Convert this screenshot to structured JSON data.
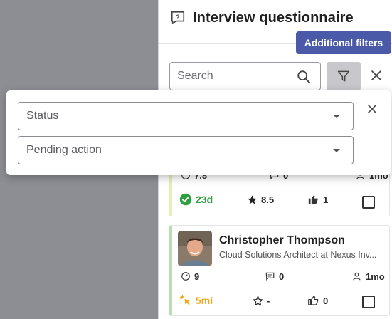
{
  "panel": {
    "title": "Interview questionnaire",
    "additional_filters_label": "Additional filters",
    "search_placeholder": "Search"
  },
  "filters": {
    "status_placeholder": "Status",
    "pending_action_placeholder": "Pending action"
  },
  "cards": [
    {
      "partial_stats": {
        "score": "7.8",
        "comments": "0",
        "time": "1mo"
      },
      "age": "23d",
      "age_color": "#2e9e3e",
      "rating": "8.5",
      "likes": "1"
    },
    {
      "name": "Christopher Thompson",
      "role": "Cloud Solutions Architect at Nexus Inv...",
      "score": "9",
      "comments": "0",
      "time": "1mo",
      "age": "5mi",
      "age_color": "#f0a81a",
      "rating": "-",
      "likes": "0"
    }
  ],
  "colors": {
    "accent": "#4a5aa8",
    "overlay": "#8d8e93"
  }
}
